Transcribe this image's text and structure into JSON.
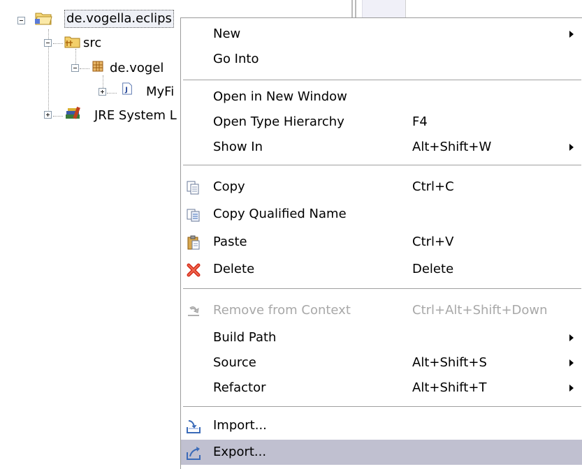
{
  "tree": {
    "root_label": "de.vogella.eclips",
    "items": [
      {
        "label": "src",
        "icon": "source-folder-icon"
      },
      {
        "label": "de.vogel",
        "icon": "package-icon"
      },
      {
        "label": "MyFi",
        "icon": "java-file-icon"
      },
      {
        "label": "JRE System L",
        "icon": "library-icon"
      }
    ]
  },
  "menu": {
    "items": [
      {
        "label": "New",
        "accel": "",
        "submenu": true
      },
      {
        "label": "Go Into",
        "accel": "",
        "submenu": false
      },
      {
        "label": "Open in New Window",
        "accel": "",
        "submenu": false
      },
      {
        "label": "Open Type Hierarchy",
        "accel": "F4",
        "submenu": false
      },
      {
        "label": "Show In",
        "accel": "Alt+Shift+W",
        "submenu": true
      },
      {
        "label": "Copy",
        "accel": "Ctrl+C",
        "icon": "copy-icon"
      },
      {
        "label": "Copy Qualified Name",
        "accel": "",
        "icon": "copy-qualified-name-icon"
      },
      {
        "label": "Paste",
        "accel": "Ctrl+V",
        "icon": "paste-icon"
      },
      {
        "label": "Delete",
        "accel": "Delete",
        "icon": "delete-icon"
      },
      {
        "label": "Remove from Context",
        "accel": "Ctrl+Alt+Shift+Down",
        "icon": "remove-context-icon",
        "disabled": true
      },
      {
        "label": "Build Path",
        "accel": "",
        "submenu": true
      },
      {
        "label": "Source",
        "accel": "Alt+Shift+S",
        "submenu": true
      },
      {
        "label": "Refactor",
        "accel": "Alt+Shift+T",
        "submenu": true
      },
      {
        "label": "Import...",
        "accel": "",
        "icon": "import-icon"
      },
      {
        "label": "Export...",
        "accel": "",
        "icon": "export-icon",
        "selected": true
      }
    ]
  },
  "colors": {
    "selection_bg": "#c0c0d0",
    "disabled_text": "#a8a8a8",
    "delete_red": "#d42a1a"
  }
}
